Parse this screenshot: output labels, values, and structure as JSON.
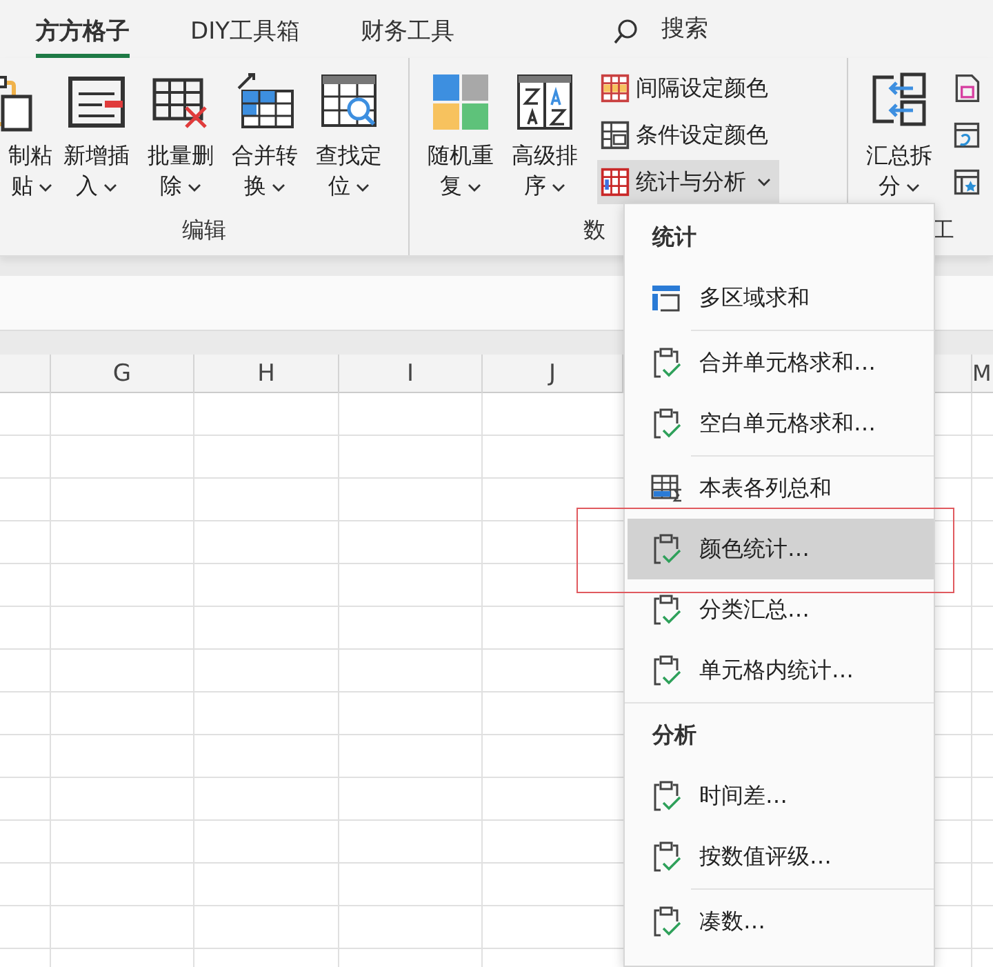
{
  "tabs": [
    {
      "label": "方方格子",
      "selected": true
    },
    {
      "label": "DIY工具箱",
      "selected": false
    },
    {
      "label": "财务工具",
      "selected": false
    }
  ],
  "search": {
    "label": "搜索"
  },
  "ribbon": {
    "groups": [
      {
        "label": "编辑",
        "buttons": [
          {
            "kind": "paste",
            "lines": [
              "制粘",
              "贴"
            ]
          },
          {
            "kind": "insert",
            "lines": [
              "新增插",
              "入"
            ]
          },
          {
            "kind": "delete",
            "lines": [
              "批量删",
              "除"
            ]
          },
          {
            "kind": "merge",
            "lines": [
              "合并转",
              "换"
            ]
          },
          {
            "kind": "find",
            "lines": [
              "查找定",
              "位"
            ]
          }
        ]
      },
      {
        "label": "数",
        "buttons": [
          {
            "kind": "random",
            "lines": [
              "随机重",
              "复"
            ]
          },
          {
            "kind": "sort",
            "lines": [
              "高级排",
              "序"
            ]
          }
        ],
        "small_buttons": [
          {
            "kind": "interval",
            "label": "间隔设定颜色",
            "expanded": false
          },
          {
            "kind": "condition",
            "label": "条件设定颜色",
            "expanded": false
          },
          {
            "kind": "stats",
            "label": "统计与分析",
            "expanded": true
          }
        ]
      },
      {
        "label": "工",
        "buttons": [
          {
            "kind": "split",
            "lines": [
              "汇总拆",
              "分"
            ]
          }
        ],
        "small_buttons": [
          {
            "kind": "save"
          },
          {
            "kind": "sheet"
          },
          {
            "kind": "tool"
          }
        ]
      }
    ]
  },
  "columns": [
    "G",
    "H",
    "I",
    "J",
    "M"
  ],
  "menu": {
    "items": [
      {
        "kind": "header",
        "label": "统计"
      },
      {
        "kind": "area",
        "label": "多区域求和",
        "selected": false,
        "outlined": false
      },
      {
        "kind": "separator"
      },
      {
        "kind": "clip",
        "label": "合并单元格求和…",
        "selected": false,
        "outlined": false
      },
      {
        "kind": "clip",
        "label": "空白单元格求和…",
        "selected": false,
        "outlined": false
      },
      {
        "kind": "separator"
      },
      {
        "kind": "table",
        "label": "本表各列总和",
        "selected": false,
        "outlined": false
      },
      {
        "kind": "clip",
        "label": "颜色统计…",
        "selected": true,
        "outlined": true
      },
      {
        "kind": "clip",
        "label": "分类汇总…",
        "selected": false,
        "outlined": false
      },
      {
        "kind": "clip",
        "label": "单元格内统计…",
        "selected": false,
        "outlined": false
      },
      {
        "kind": "rule"
      },
      {
        "kind": "header",
        "label": "分析"
      },
      {
        "kind": "clip",
        "label": "时间差…",
        "selected": false,
        "outlined": false
      },
      {
        "kind": "clip",
        "label": "按数值评级…",
        "selected": false,
        "outlined": false
      },
      {
        "kind": "separator"
      },
      {
        "kind": "clip",
        "label": "凑数…",
        "selected": false,
        "outlined": false
      }
    ]
  }
}
